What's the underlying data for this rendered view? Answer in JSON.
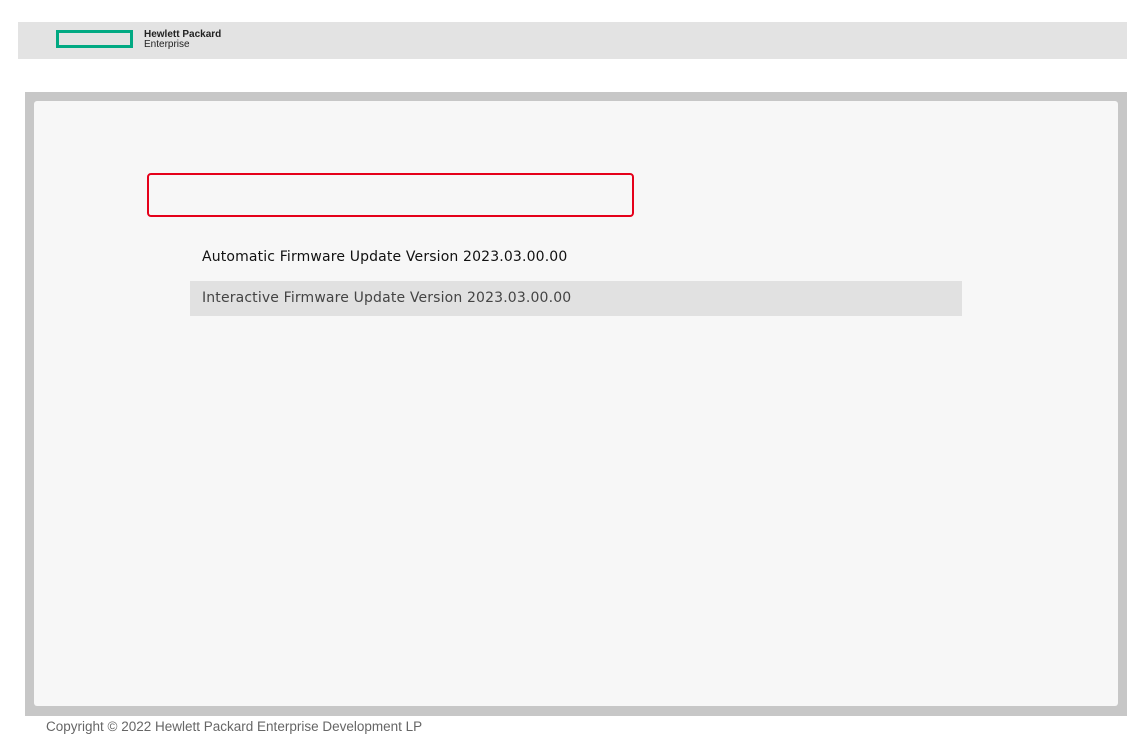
{
  "header": {
    "logo_line1": "Hewlett Packard",
    "logo_line2": "Enterprise",
    "logo_color": "#01a982"
  },
  "menu": {
    "items": [
      {
        "label": "Automatic Firmware Update Version 2023.03.00.00",
        "selected": false
      },
      {
        "label": "Interactive Firmware Update Version 2023.03.00.00",
        "selected": true
      }
    ]
  },
  "annotation": {
    "highlight_color": "#e5001a",
    "target": "Interactive Firmware Update Version 2023.03.00.00"
  },
  "footer": {
    "copyright": "Copyright © 2022 Hewlett Packard Enterprise Development LP"
  }
}
